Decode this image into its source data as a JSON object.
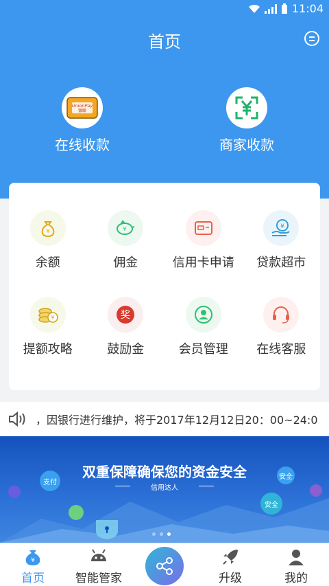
{
  "status_bar": {
    "time": "11:04"
  },
  "header": {
    "title": "首页"
  },
  "hero_actions": [
    {
      "label": "在线收款",
      "icon": "unionpay-card-icon"
    },
    {
      "label": "商家收款",
      "icon": "scan-qr-yuan-icon"
    }
  ],
  "unionpay": {
    "brand": "UnionPay",
    "sub": "银联"
  },
  "grid": [
    {
      "label": "余额",
      "icon": "money-bag-icon"
    },
    {
      "label": "佣金",
      "icon": "piggy-bank-icon"
    },
    {
      "label": "信用卡申请",
      "icon": "credit-card-icon"
    },
    {
      "label": "贷款超市",
      "icon": "loan-hand-icon"
    },
    {
      "label": "提额攻略",
      "icon": "coins-icon"
    },
    {
      "label": "鼓励金",
      "icon": "reward-icon"
    },
    {
      "label": "会员管理",
      "icon": "member-icon"
    },
    {
      "label": "在线客服",
      "icon": "headset-icon"
    }
  ],
  "reward_char": "奖",
  "notice": {
    "text": "，因银行进行维护，将于2017年12月12日20：00~24:0"
  },
  "banner": {
    "headline": "双重保障确保您的资金安全",
    "sub": "信用达人",
    "tags": [
      "支付",
      "安全",
      "安全"
    ]
  },
  "tabbar": [
    {
      "label": "首页",
      "icon": "home-moneybag-icon"
    },
    {
      "label": "智能管家",
      "icon": "robot-icon"
    },
    {
      "label": "升级",
      "icon": "rocket-icon"
    },
    {
      "label": "我的",
      "icon": "user-icon"
    }
  ],
  "colors": {
    "primary": "#3d97ee",
    "banner": "#1352bc"
  }
}
